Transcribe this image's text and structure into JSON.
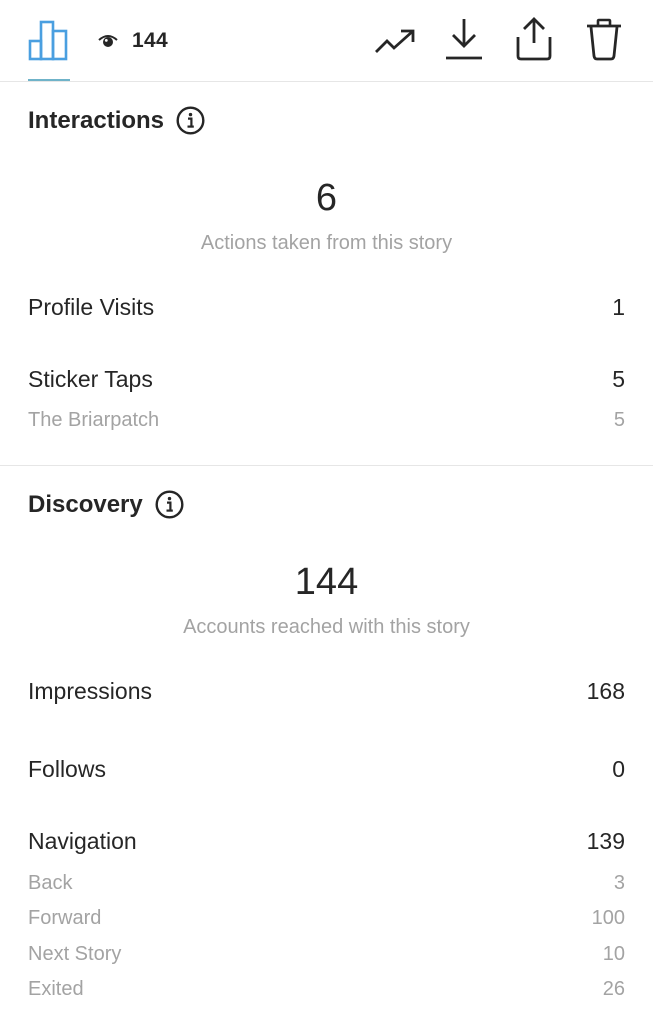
{
  "header": {
    "views_count": "144",
    "icons": {
      "chart": "bar-chart-icon",
      "views": "eye-icon",
      "insights": "trending-up-icon",
      "download": "download-icon",
      "share": "share-icon",
      "delete": "trash-icon"
    },
    "accent_color": "#4a9fe0"
  },
  "interactions": {
    "title": "Interactions",
    "total": "6",
    "total_label": "Actions taken from this story",
    "rows": [
      {
        "label": "Profile Visits",
        "value": "1"
      },
      {
        "label": "Sticker Taps",
        "value": "5"
      }
    ],
    "sticker_sub": {
      "label": "The Briarpatch",
      "value": "5"
    }
  },
  "discovery": {
    "title": "Discovery",
    "total": "144",
    "total_label": "Accounts reached with this story",
    "rows": [
      {
        "label": "Impressions",
        "value": "168"
      },
      {
        "label": "Follows",
        "value": "0"
      },
      {
        "label": "Navigation",
        "value": "139"
      }
    ],
    "navigation_breakdown": [
      {
        "label": "Back",
        "value": "3"
      },
      {
        "label": "Forward",
        "value": "100"
      },
      {
        "label": "Next Story",
        "value": "10"
      },
      {
        "label": "Exited",
        "value": "26"
      }
    ]
  }
}
